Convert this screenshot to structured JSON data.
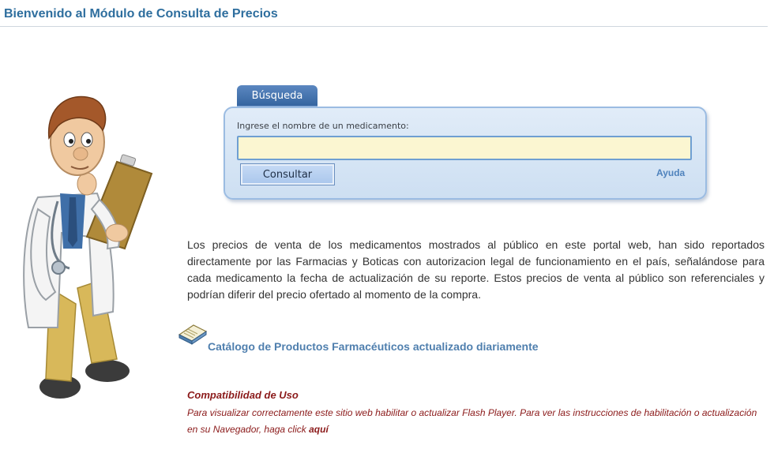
{
  "header": {
    "title": "Bienvenido al Módulo de Consulta de Precios"
  },
  "search": {
    "tab_label": "Búsqueda",
    "field_label": "Ingrese el nombre de un medicamento:",
    "input_value": "",
    "input_placeholder": "",
    "button_label": "Consultar",
    "help_link": "Ayuda"
  },
  "info": {
    "paragraph": "Los precios de venta de los medicamentos mostrados al público en este portal web, han sido reportados directamente por las Farmacias y Boticas con autorizacion legal de funcionamiento en el país, señalándose para cada medicamento la fecha de actualización de su reporte. Estos precios de venta al público son referenciales y podrían diferir del precio ofertado al momento de la compra."
  },
  "catalog": {
    "icon": "open-book-icon",
    "link_text": "Catálogo de Productos Farmacéuticos actualizado diariamente"
  },
  "compatibility": {
    "heading": "Compatibilidad de Uso",
    "text": "Para visualizar correctamente este sitio web habilitar o actualizar Flash Player. Para ver las instrucciones de habilitación o actualización en su Navegador, haga click",
    "link_text": "aquí"
  },
  "illustration": {
    "icon": "doctor-with-clipboard-illustration"
  },
  "colors": {
    "title": "#2e6e9e",
    "tab": "#34649f",
    "panel_border": "#9bbce2",
    "input_bg": "#fbf6d1",
    "compat_text": "#8b1a1a"
  }
}
